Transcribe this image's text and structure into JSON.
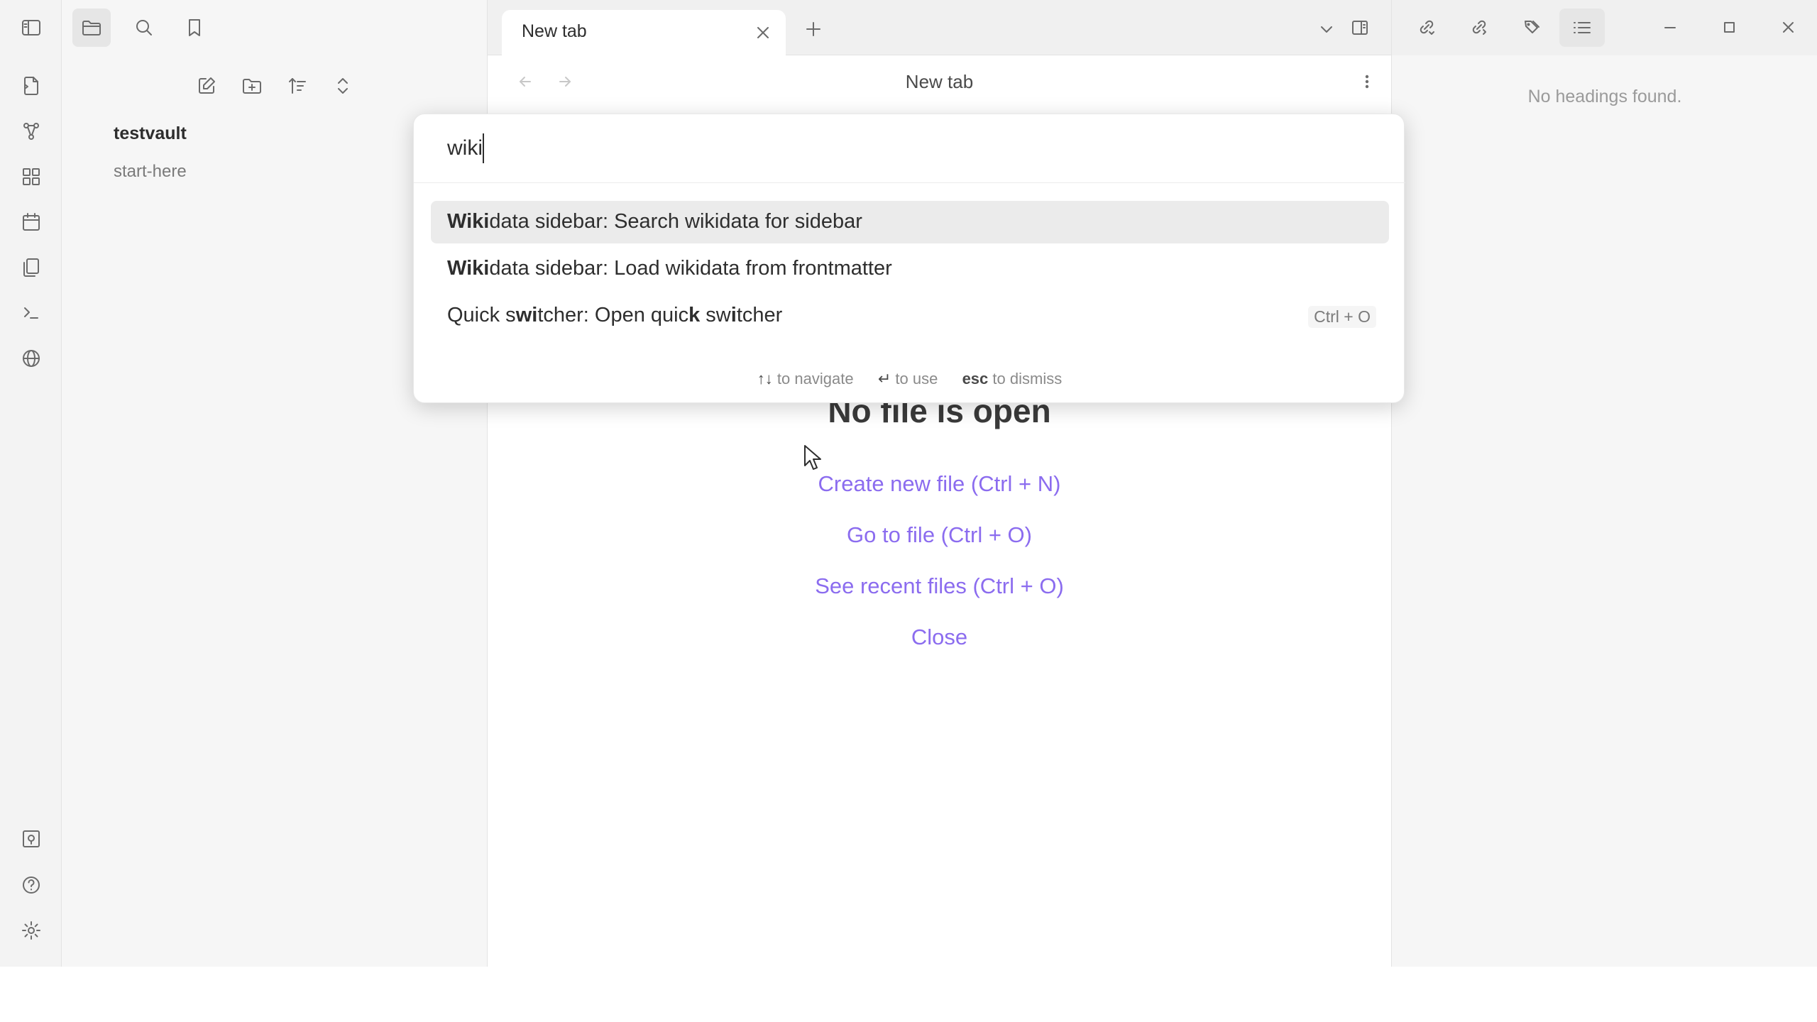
{
  "tabbar": {
    "tab_title": "New tab"
  },
  "sidebar": {
    "vault_name": "testvault",
    "files": [
      "start-here"
    ]
  },
  "main": {
    "view_title": "New tab",
    "empty_state": {
      "title": "No file is open",
      "actions": [
        "Create new file (Ctrl + N)",
        "Go to file (Ctrl + O)",
        "See recent files (Ctrl + O)",
        "Close"
      ]
    }
  },
  "right_sidebar": {
    "outline_message": "No headings found."
  },
  "command_palette": {
    "query": "wiki",
    "suggestions": [
      {
        "label": "Wikidata sidebar: Search wikidata for sidebar",
        "hotkey": ""
      },
      {
        "label": "Wikidata sidebar: Load wikidata from frontmatter",
        "hotkey": ""
      },
      {
        "label": "Quick switcher: Open quick switcher",
        "hotkey": "Ctrl + O"
      }
    ],
    "instructions": {
      "navigate_key": "↑↓",
      "navigate": "to navigate",
      "use_key": "↵",
      "use": "to use",
      "dismiss_key": "esc",
      "dismiss": "to dismiss"
    }
  },
  "colors": {
    "accent": "#8b6cef",
    "background": "#f6f6f6",
    "modal_background": "#ffffff"
  },
  "icons": {
    "ribbon": [
      "sidebar-toggle-icon",
      "open-quick-switcher-icon",
      "graph-view-icon",
      "canvas-icon",
      "daily-note-icon",
      "templates-icon",
      "command-palette-icon",
      "web-icon",
      "vault-switch-icon",
      "help-icon",
      "settings-icon"
    ],
    "explorer_header": [
      "files-icon",
      "search-icon",
      "bookmark-icon"
    ],
    "explorer_actions": [
      "new-note-icon",
      "new-folder-icon",
      "sort-icon",
      "collapse-icon"
    ],
    "window": [
      "chevron-down-icon",
      "right-sidebar-toggle-icon",
      "backlinks-icon",
      "outgoing-links-icon",
      "tags-icon",
      "outline-icon",
      "minimize-icon",
      "maximize-icon",
      "close-icon"
    ]
  }
}
